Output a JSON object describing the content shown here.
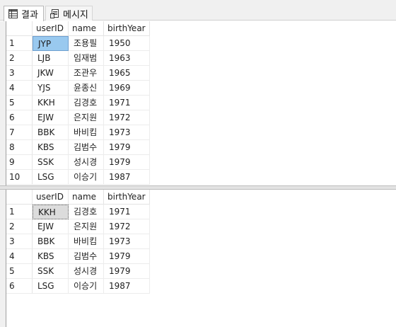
{
  "tabs": [
    {
      "label": "결과",
      "icon": "grid-icon"
    },
    {
      "label": "메시지",
      "icon": "message-icon"
    }
  ],
  "columns": [
    "userID",
    "name",
    "birthYear"
  ],
  "result1": {
    "rows": [
      {
        "num": "1",
        "userID": "JYP",
        "name": "조용필",
        "birthYear": "1950"
      },
      {
        "num": "2",
        "userID": "LJB",
        "name": "임재범",
        "birthYear": "1963"
      },
      {
        "num": "3",
        "userID": "JKW",
        "name": "조관우",
        "birthYear": "1965"
      },
      {
        "num": "4",
        "userID": "YJS",
        "name": "윤종신",
        "birthYear": "1969"
      },
      {
        "num": "5",
        "userID": "KKH",
        "name": "김경호",
        "birthYear": "1971"
      },
      {
        "num": "6",
        "userID": "EJW",
        "name": "은지원",
        "birthYear": "1972"
      },
      {
        "num": "7",
        "userID": "BBK",
        "name": "바비킴",
        "birthYear": "1973"
      },
      {
        "num": "8",
        "userID": "KBS",
        "name": "김범수",
        "birthYear": "1979"
      },
      {
        "num": "9",
        "userID": "SSK",
        "name": "성시경",
        "birthYear": "1979"
      },
      {
        "num": "10",
        "userID": "LSG",
        "name": "이승기",
        "birthYear": "1987"
      }
    ]
  },
  "result2": {
    "rows": [
      {
        "num": "1",
        "userID": "KKH",
        "name": "김경호",
        "birthYear": "1971"
      },
      {
        "num": "2",
        "userID": "EJW",
        "name": "은지원",
        "birthYear": "1972"
      },
      {
        "num": "3",
        "userID": "BBK",
        "name": "바비킴",
        "birthYear": "1973"
      },
      {
        "num": "4",
        "userID": "KBS",
        "name": "김범수",
        "birthYear": "1979"
      },
      {
        "num": "5",
        "userID": "SSK",
        "name": "성시경",
        "birthYear": "1979"
      },
      {
        "num": "6",
        "userID": "LSG",
        "name": "이승기",
        "birthYear": "1987"
      }
    ]
  }
}
